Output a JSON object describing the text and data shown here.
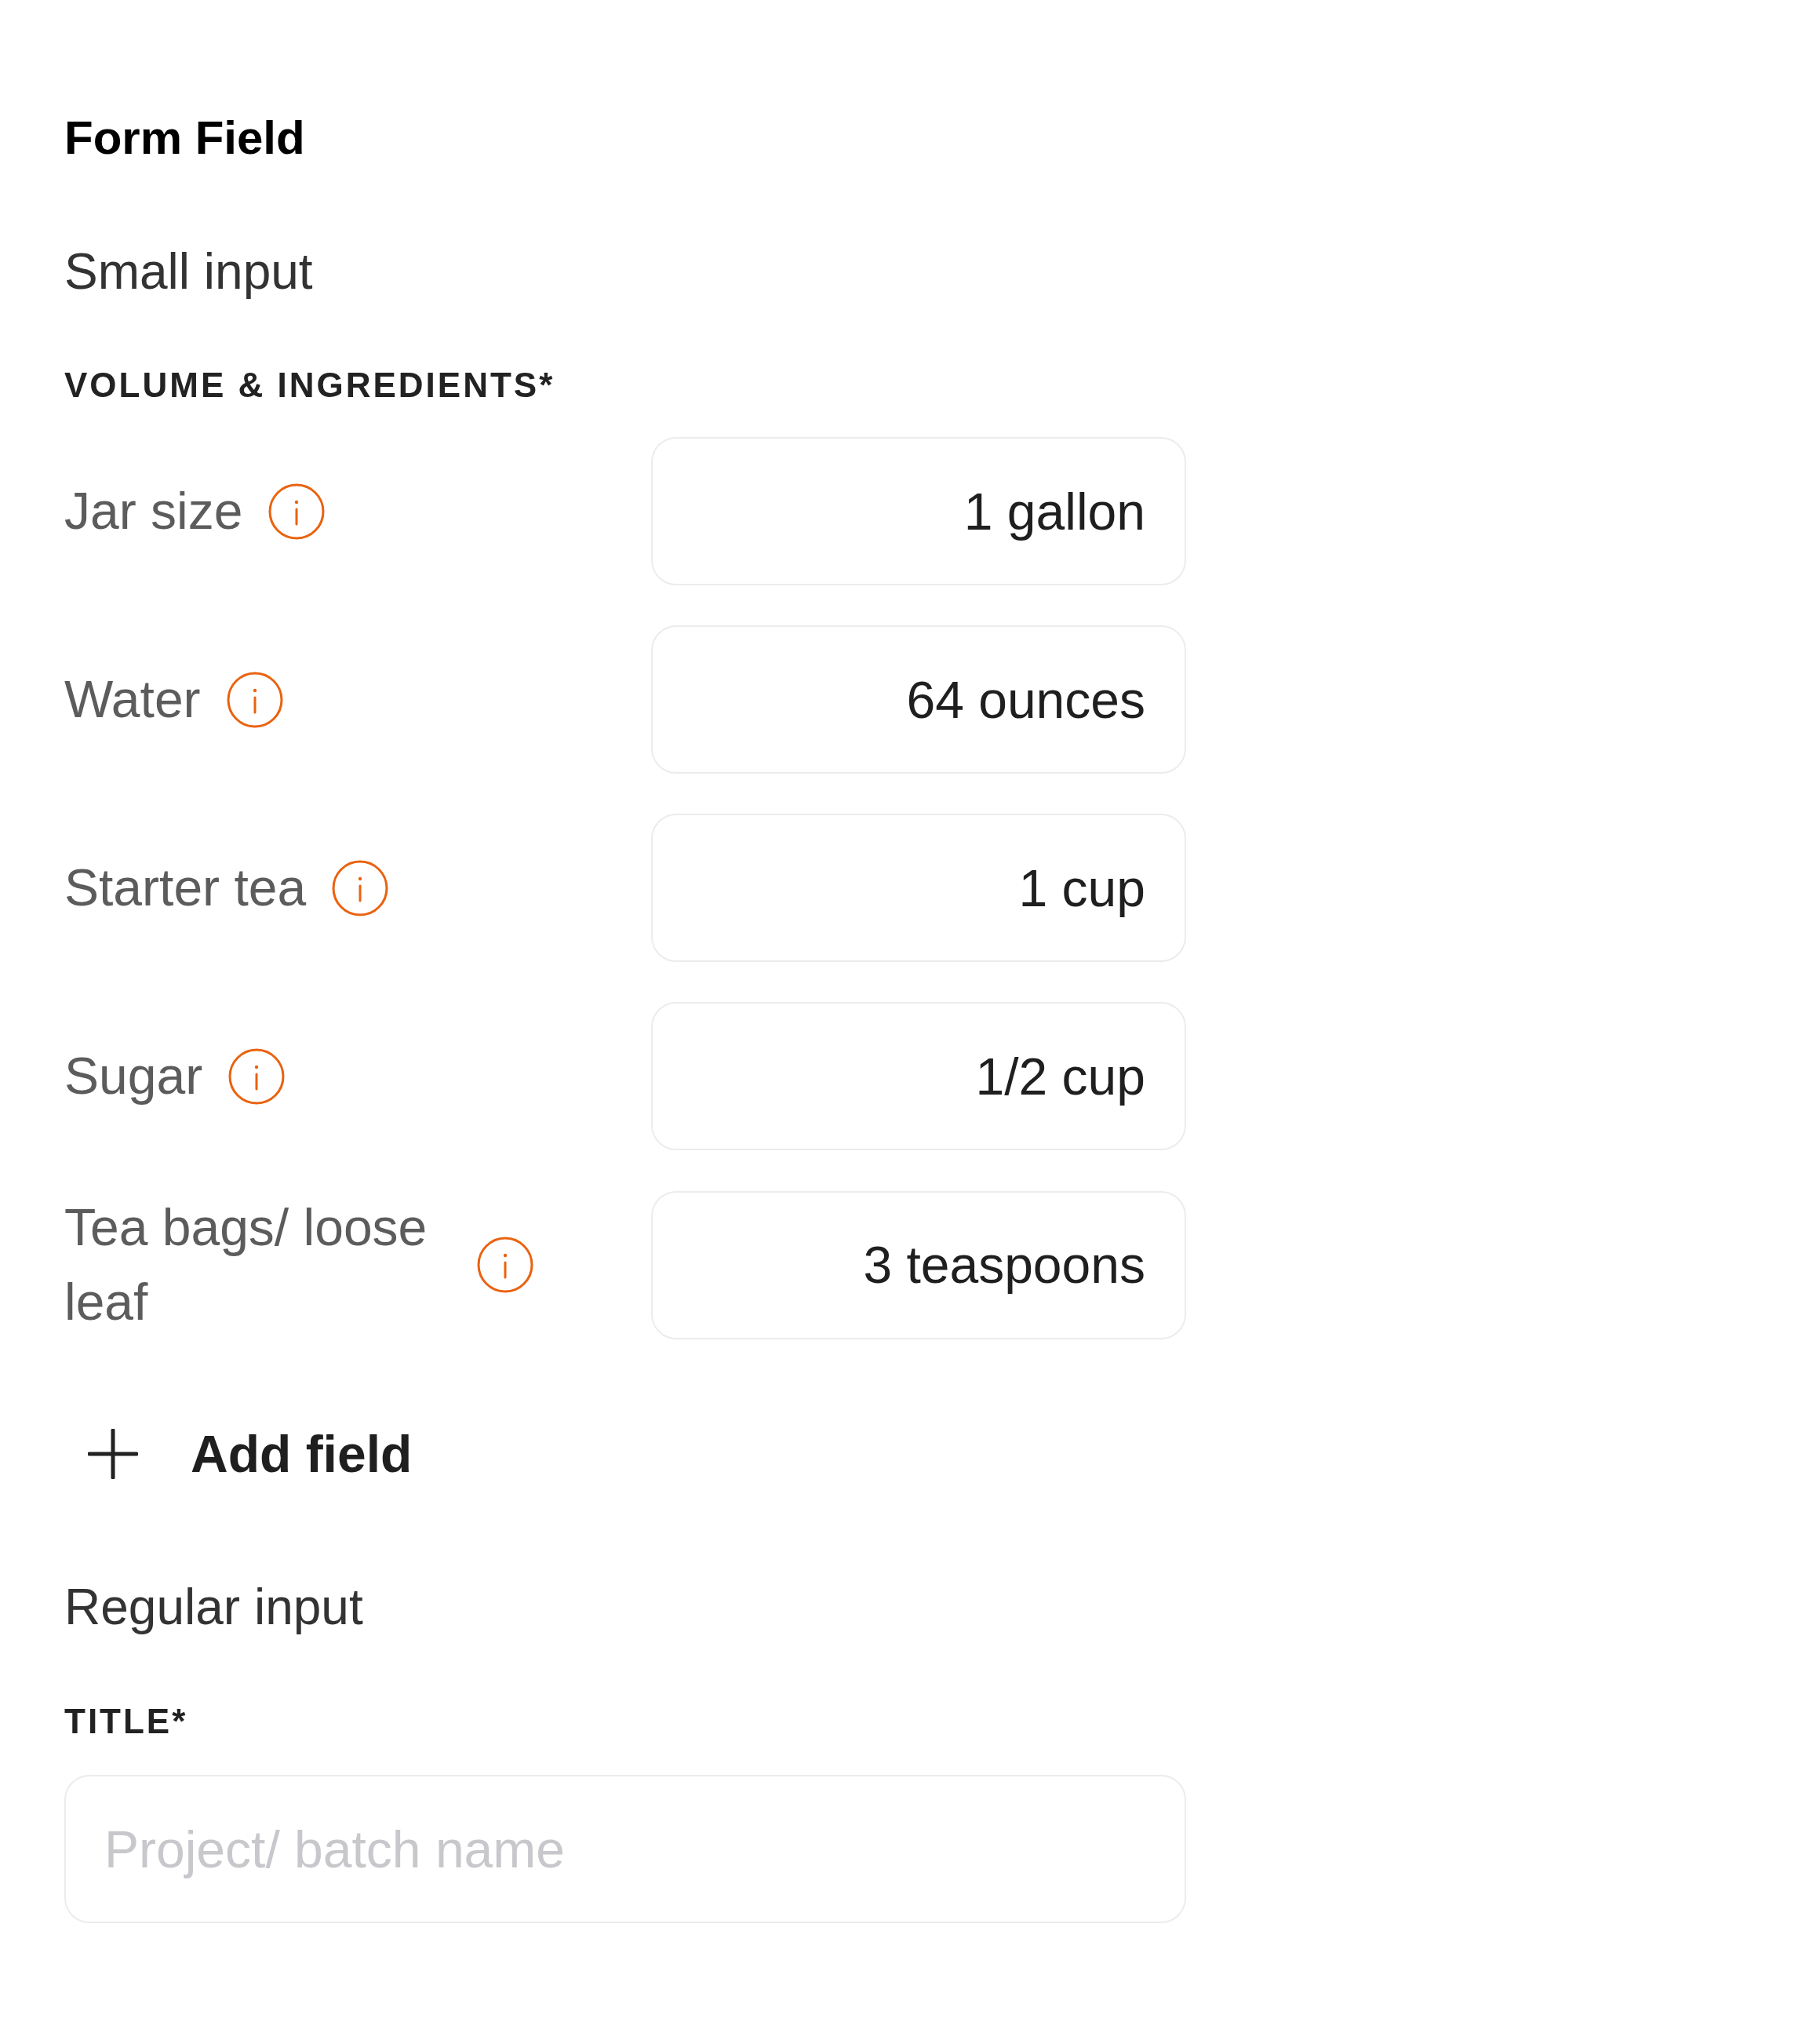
{
  "page_title": "Form Field",
  "small_input": {
    "heading": "Small input",
    "group_label": "VOLUME & INGREDIENTS*",
    "fields": [
      {
        "label": "Jar size",
        "value": "1 gallon"
      },
      {
        "label": "Water",
        "value": "64 ounces"
      },
      {
        "label": "Starter tea",
        "value": "1 cup"
      },
      {
        "label": "Sugar",
        "value": "1/2 cup"
      },
      {
        "label": "Tea bags/ loose leaf",
        "value": "3 teaspoons"
      }
    ],
    "add_button": "Add field"
  },
  "regular_input": {
    "heading": "Regular input",
    "label": "TITLE*",
    "placeholder": "Project/ batch name"
  }
}
